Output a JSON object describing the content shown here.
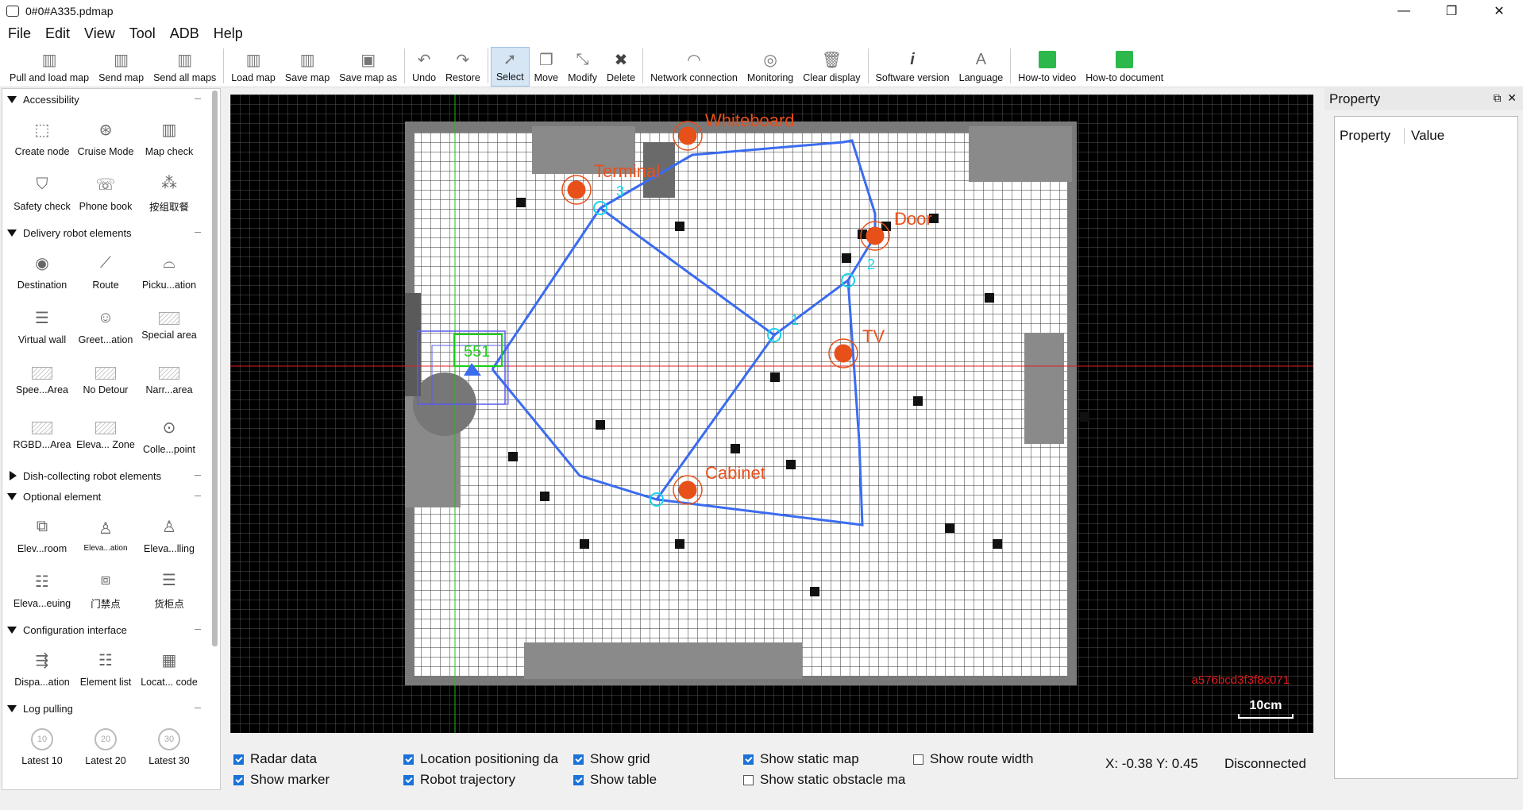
{
  "window": {
    "title": "0#0#A335.pdmap"
  },
  "menu": [
    "File",
    "Edit",
    "View",
    "Tool",
    "ADB",
    "Help"
  ],
  "toolbar": [
    {
      "label": "Pull and load map",
      "icon": "map-icon"
    },
    {
      "label": "Send map",
      "icon": "map-send-icon"
    },
    {
      "label": "Send all maps",
      "icon": "map-send-all-icon"
    },
    {
      "label": "Load map",
      "icon": "map-icon"
    },
    {
      "label": "Save map",
      "icon": "map-save-icon"
    },
    {
      "label": "Save map as",
      "icon": "floppy-icon"
    },
    {
      "label": "Undo",
      "icon": "undo-icon"
    },
    {
      "label": "Restore",
      "icon": "redo-icon"
    },
    {
      "label": "Select",
      "icon": "cursor-icon"
    },
    {
      "label": "Move",
      "icon": "move-icon"
    },
    {
      "label": "Modify",
      "icon": "modify-icon"
    },
    {
      "label": "Delete",
      "icon": "delete-icon"
    },
    {
      "label": "Network connection",
      "icon": "wifi-icon"
    },
    {
      "label": "Monitoring",
      "icon": "monitor-icon"
    },
    {
      "label": "Clear display",
      "icon": "trash-icon"
    },
    {
      "label": "Software version",
      "icon": "info-icon"
    },
    {
      "label": "Language",
      "icon": "language-icon"
    },
    {
      "label": "How-to video",
      "icon": "video-icon"
    },
    {
      "label": "How-to document",
      "icon": "document-icon"
    }
  ],
  "left": {
    "accessibility": {
      "title": "Accessibility",
      "items": [
        "Create node",
        "Cruise Mode",
        "Map check",
        "Safety check",
        "Phone book",
        "按组取餐"
      ]
    },
    "delivery": {
      "title": "Delivery robot elements",
      "items": [
        "Destination",
        "Route",
        "Picku...ation",
        "Virtual wall",
        "Greet...ation",
        "Special area",
        "Spee...Area",
        "No Detour",
        "Narr...area",
        "RGBD...Area",
        "Eleva... Zone",
        "Colle...point"
      ]
    },
    "dish": {
      "title": "Dish-collecting robot elements"
    },
    "optional": {
      "title": "Optional element",
      "items": [
        "Elev...room",
        "Eleva...ation",
        "Eleva...lling",
        "Eleva...euing",
        "门禁点",
        "货柜点"
      ]
    },
    "config": {
      "title": "Configuration interface",
      "items": [
        "Dispa...ation",
        "Element list",
        "Locat... code"
      ]
    },
    "log": {
      "title": "Log pulling",
      "items": [
        {
          "label": "Latest 10",
          "icon_text": "10"
        },
        {
          "label": "Latest 20",
          "icon_text": "20"
        },
        {
          "label": "Latest 30",
          "icon_text": "30"
        }
      ]
    }
  },
  "map": {
    "labels": [
      "Whiteboard",
      "Terminal",
      "Door",
      "TV",
      "Cabinet"
    ],
    "node_numbers": [
      "3",
      "2",
      "1"
    ],
    "robot_id": "551",
    "map_id": "a576bcd3f3f8c071",
    "scale": "10cm",
    "colors": {
      "route": "#3a6cf0",
      "destination": "#e8501a",
      "node": "#19d4e8",
      "axis_x": "#e02020",
      "axis_y": "#19c019"
    }
  },
  "checks": [
    {
      "label": "Radar data",
      "checked": true
    },
    {
      "label": "Show marker",
      "checked": true
    },
    {
      "label": "Location positioning da",
      "checked": true
    },
    {
      "label": "Robot trajectory",
      "checked": true
    },
    {
      "label": "Show grid",
      "checked": true
    },
    {
      "label": "Show table",
      "checked": true
    },
    {
      "label": "Show static map",
      "checked": true
    },
    {
      "label": "Show static obstacle ma",
      "checked": false
    },
    {
      "label": "Show route width",
      "checked": false
    }
  ],
  "status": {
    "coords": "X: -0.38  Y: 0.45",
    "connection": "Disconnected"
  },
  "property": {
    "title": "Property",
    "col_property": "Property",
    "col_value": "Value"
  }
}
